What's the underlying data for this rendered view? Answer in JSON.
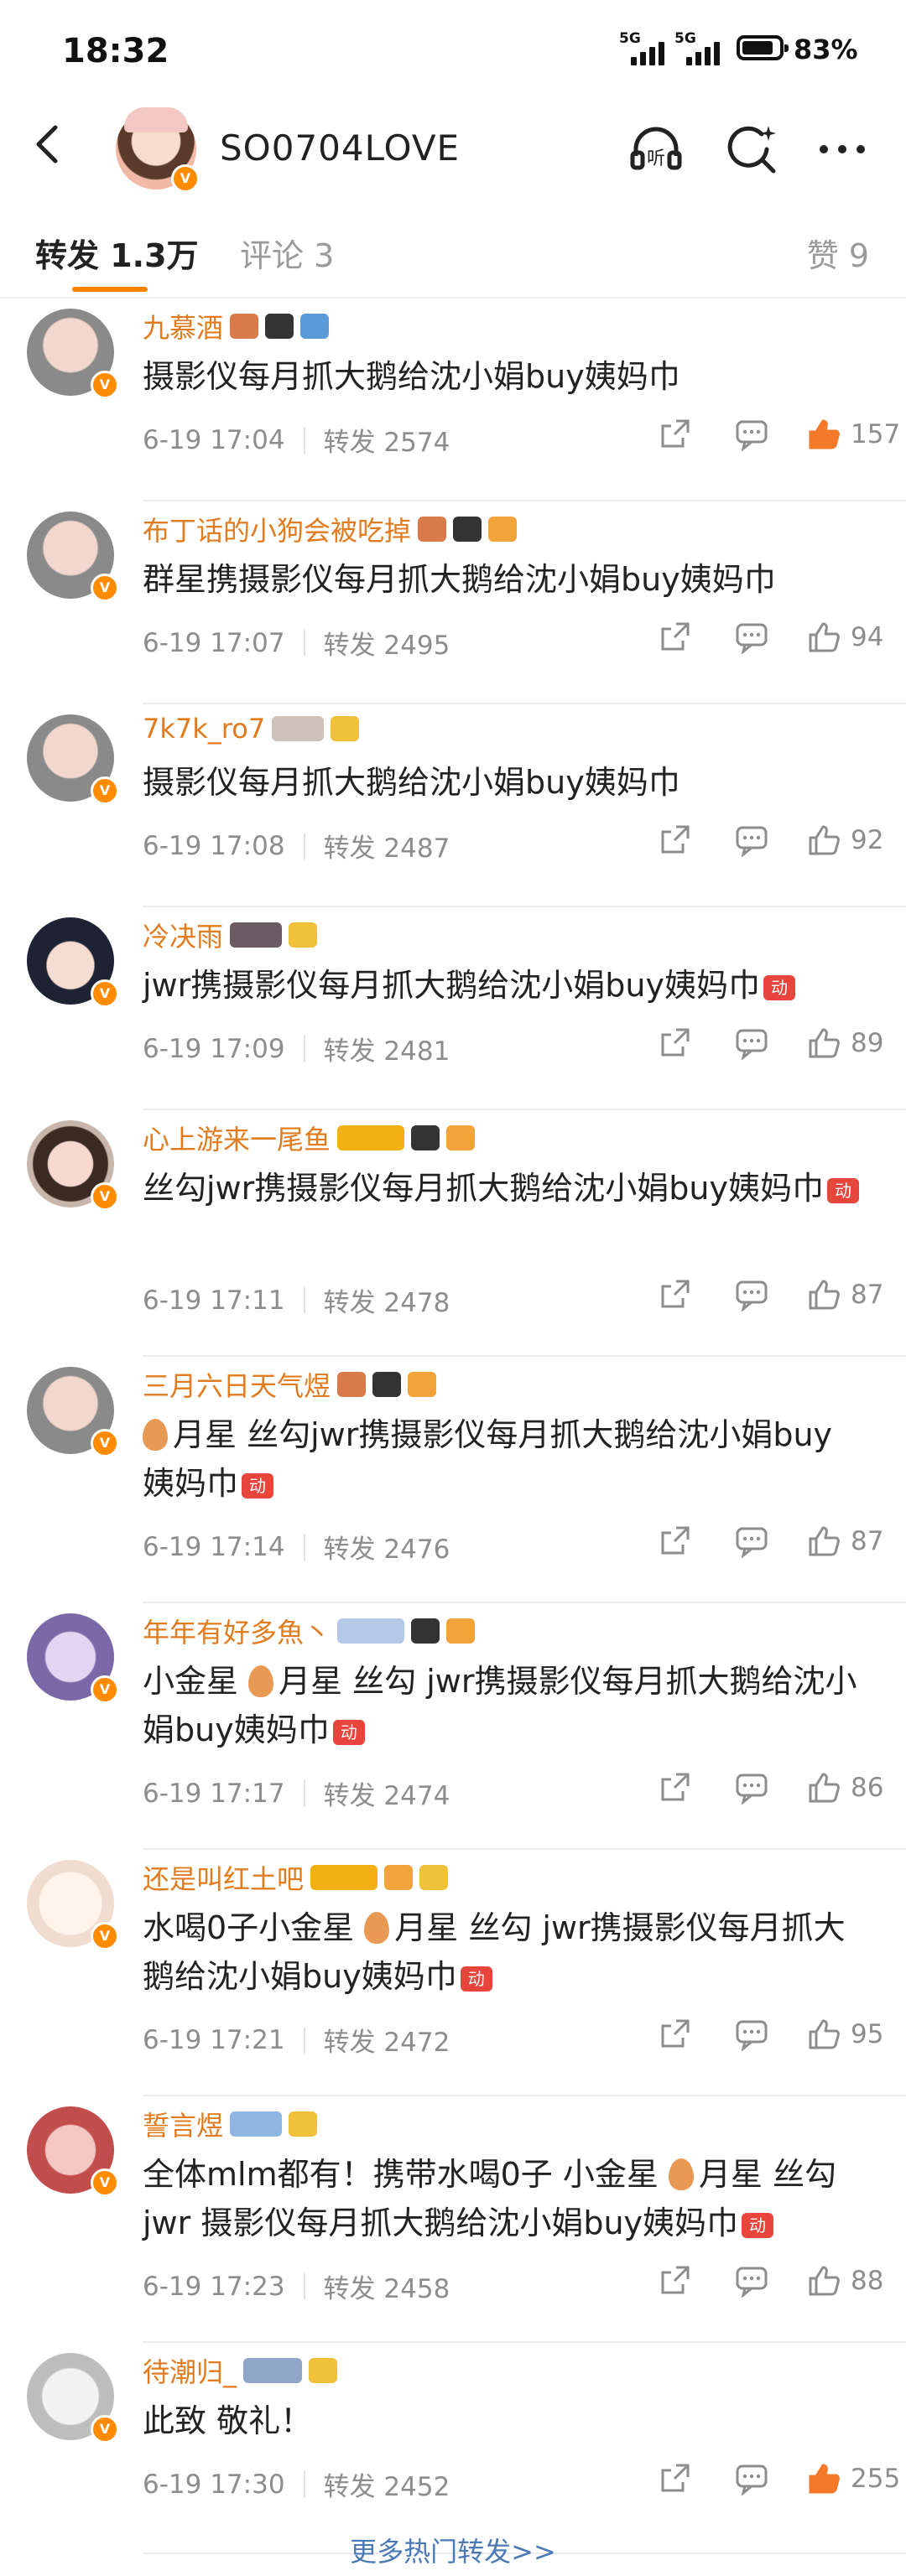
{
  "status_bar": {
    "time": "18:32",
    "net1": "5G",
    "net2": "5G",
    "battery": "83%"
  },
  "header": {
    "title": "SO0704LOVE",
    "icons": [
      "back-arrow-icon",
      "listen-headphones-icon",
      "search-sparkle-icon",
      "more-dots-icon"
    ],
    "listen_label": "听"
  },
  "tabs": {
    "repost": "转发 1.3万",
    "comment": "评论 3",
    "likes": "赞 9"
  },
  "reposts": [
    {
      "name": "九慕酒",
      "text": "摄影仪每月抓大鹅给沈小娟buy姨妈巾",
      "time": "6-19 17:04",
      "repost": "转发 2574",
      "likes": "157",
      "liked": true
    },
    {
      "name": "布丁话的小狗会被吃掉",
      "text": "群星携摄影仪每月抓大鹅给沈小娟buy姨妈巾",
      "time": "6-19 17:07",
      "repost": "转发 2495",
      "likes": "94",
      "liked": false
    },
    {
      "name": "7k7k_ro7",
      "text": "摄影仪每月抓大鹅给沈小娟buy姨妈巾",
      "time": "6-19 17:08",
      "repost": "转发 2487",
      "likes": "92",
      "liked": false
    },
    {
      "name": "冷决雨",
      "text": "jwr携摄影仪每月抓大鹅给沈小娟buy姨妈巾",
      "time": "6-19 17:09",
      "repost": "转发 2481",
      "likes": "89",
      "liked": false
    },
    {
      "name": "心上游来一尾鱼",
      "text": "丝勾jwr携摄影仪每月抓大鹅给沈小娟buy姨妈巾",
      "time": "6-19 17:11",
      "repost": "转发 2478",
      "likes": "87",
      "liked": false
    },
    {
      "name": "三月六日天气煜",
      "text": "月星 丝勾jwr携摄影仪每月抓大鹅给沈小娟buy姨妈巾",
      "time": "6-19 17:14",
      "repost": "转发 2476",
      "likes": "87",
      "liked": false
    },
    {
      "name": "年年有好多魚丶",
      "text": "小金星 月星 丝勾 jwr携摄影仪每月抓大鹅给沈小娟buy姨妈巾",
      "time": "6-19 17:17",
      "repost": "转发 2474",
      "likes": "86",
      "liked": false
    },
    {
      "name": "还是叫红土吧",
      "text": "水喝0子小金星 月星 丝勾 jwr携摄影仪每月抓大鹅给沈小娟buy姨妈巾",
      "time": "6-19 17:21",
      "repost": "转发 2472",
      "likes": "95",
      "liked": false
    },
    {
      "name": "誓言煜",
      "text": "全体mlm都有！携带水喝0子 小金星 月星 丝勾 jwr 摄影仪每月抓大鹅给沈小娟buy姨妈巾",
      "time": "6-19 17:23",
      "repost": "转发 2458",
      "likes": "88",
      "liked": false
    },
    {
      "name": "待潮归_",
      "text": "此致 敬礼！",
      "time": "6-19 17:30",
      "repost": "转发 2452",
      "likes": "255",
      "liked": true
    }
  ],
  "tag_label": "动",
  "more_link": "更多热门转发>>",
  "colors": {
    "accent": "#ff8200",
    "username": "#e27b1d",
    "link": "#4a79b6",
    "verified": "#ff8b00",
    "like_active": "#f47a2a"
  }
}
